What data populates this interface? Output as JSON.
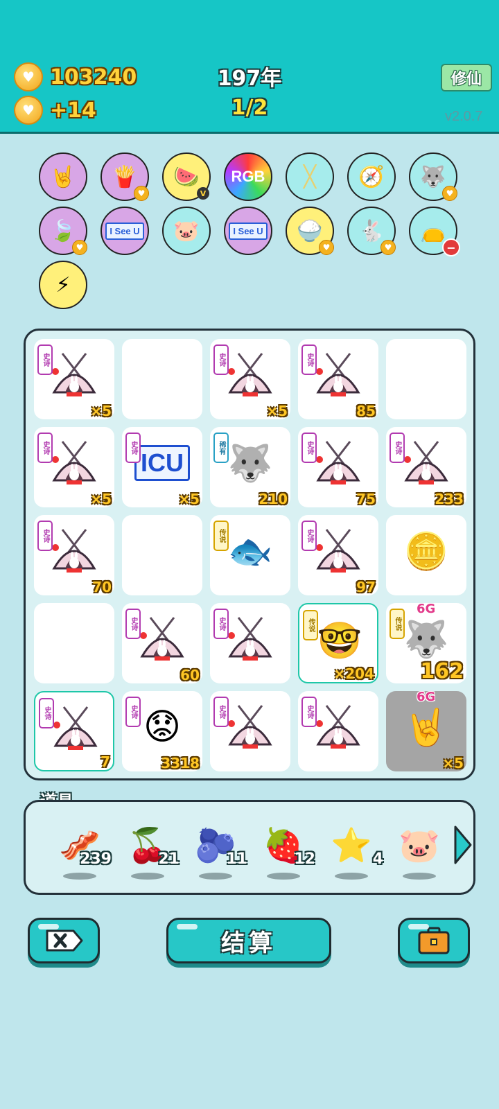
{
  "header": {
    "coins": "103240",
    "income": "+14",
    "year": "197年",
    "page": "1/2",
    "cultivate_label": "修仙",
    "version": "v2.0.7"
  },
  "buffs": [
    {
      "icon": "rock-hand-icon",
      "glyph": "🤘",
      "bg": "#d8a6e6"
    },
    {
      "icon": "fries-icon",
      "glyph": "🍟",
      "bg": "#d8a6e6",
      "heart": true
    },
    {
      "icon": "fruit-bowl-icon",
      "glyph": "🍉",
      "bg": "#fff07a",
      "v": true
    },
    {
      "icon": "rgb-icon",
      "glyph": "RGB",
      "bg": "rainbow"
    },
    {
      "icon": "chopsticks-icon",
      "glyph": "╳",
      "bg": "#a6ecec"
    },
    {
      "icon": "compass-icon",
      "glyph": "🧭",
      "bg": "#a6ecec"
    },
    {
      "icon": "husky-icon",
      "glyph": "🐺",
      "bg": "#a6ecec",
      "heart": true
    },
    {
      "icon": "leaf-icon",
      "glyph": "🍃",
      "bg": "#d8a6e6",
      "heart": true
    },
    {
      "icon": "i-see-u-icon",
      "glyph": "I See U",
      "bg": "#d8a6e6"
    },
    {
      "icon": "piggy-bank-icon",
      "glyph": "🐷",
      "bg": "#a6ecec"
    },
    {
      "icon": "i-see-u-icon",
      "glyph": "I See U",
      "bg": "#d8a6e6"
    },
    {
      "icon": "rice-bowl-icon",
      "glyph": "🍚",
      "bg": "#fff07a",
      "heart": true
    },
    {
      "icon": "rabbit-icon",
      "glyph": "🐇",
      "bg": "#a6ecec",
      "heart": true
    },
    {
      "icon": "sack-icon",
      "glyph": "👝",
      "bg": "#a6ecec",
      "minus": true
    },
    {
      "icon": "lightning-icon",
      "glyph": "⚡",
      "bg": "#fff07a"
    }
  ],
  "grid": [
    {
      "type": "tent",
      "tag": "史诗",
      "count": "×5"
    },
    {
      "type": "empty"
    },
    {
      "type": "tent",
      "tag": "史诗",
      "count": "×5"
    },
    {
      "type": "tent",
      "tag": "史诗",
      "count": "85"
    },
    {
      "type": "empty"
    },
    {
      "type": "tent",
      "tag": "史诗",
      "count": "×5"
    },
    {
      "type": "icu",
      "tag": "史诗",
      "label": "ICU",
      "count": "×5"
    },
    {
      "type": "husky",
      "tag": "稀有",
      "count": "210"
    },
    {
      "type": "tent",
      "tag": "史诗",
      "count": "75"
    },
    {
      "type": "tent",
      "tag": "史诗",
      "count": "233"
    },
    {
      "type": "tent",
      "tag": "史诗",
      "count": "70"
    },
    {
      "type": "empty"
    },
    {
      "type": "koi",
      "tag": "传说"
    },
    {
      "type": "tent",
      "tag": "史诗",
      "count": "97"
    },
    {
      "type": "coins"
    },
    {
      "type": "empty"
    },
    {
      "type": "tent",
      "tag": "史诗",
      "count": "60"
    },
    {
      "type": "tent",
      "tag": "史诗"
    },
    {
      "type": "king",
      "tag": "传说",
      "count": "×204",
      "selected": true
    },
    {
      "type": "husky-king",
      "tag": "传说",
      "net": "6G",
      "count": "162",
      "big": true
    },
    {
      "type": "tent",
      "tag": "史诗",
      "count": "7",
      "selected": true
    },
    {
      "type": "bearded-king",
      "tag": "史诗",
      "count": "3318"
    },
    {
      "type": "tent",
      "tag": "史诗"
    },
    {
      "type": "tent",
      "tag": "史诗"
    },
    {
      "type": "hand",
      "net": "6G",
      "count": "×5",
      "gray": true
    }
  ],
  "items": {
    "title": "道具",
    "list": [
      {
        "icon": "liver-icon",
        "glyph": "🥓",
        "qty": "239"
      },
      {
        "icon": "bayberry-icon",
        "glyph": "🍒",
        "qty": "21"
      },
      {
        "icon": "blueberry-icon",
        "glyph": "🫐",
        "qty": "11"
      },
      {
        "icon": "strawberry-icon",
        "glyph": "🍓",
        "qty": "12"
      },
      {
        "icon": "star-icon",
        "glyph": "⭐",
        "qty": "4"
      },
      {
        "icon": "piggy-bank-icon",
        "glyph": "🐷",
        "qty": ""
      }
    ]
  },
  "buttons": {
    "settle_label": "结算"
  },
  "colors": {
    "teal": "#16c6c6",
    "bg": "#bfe6ec",
    "gold": "#ffc624",
    "epic": "#b23bb0",
    "rare": "#2aa1c5",
    "legend": "#d6a400"
  }
}
